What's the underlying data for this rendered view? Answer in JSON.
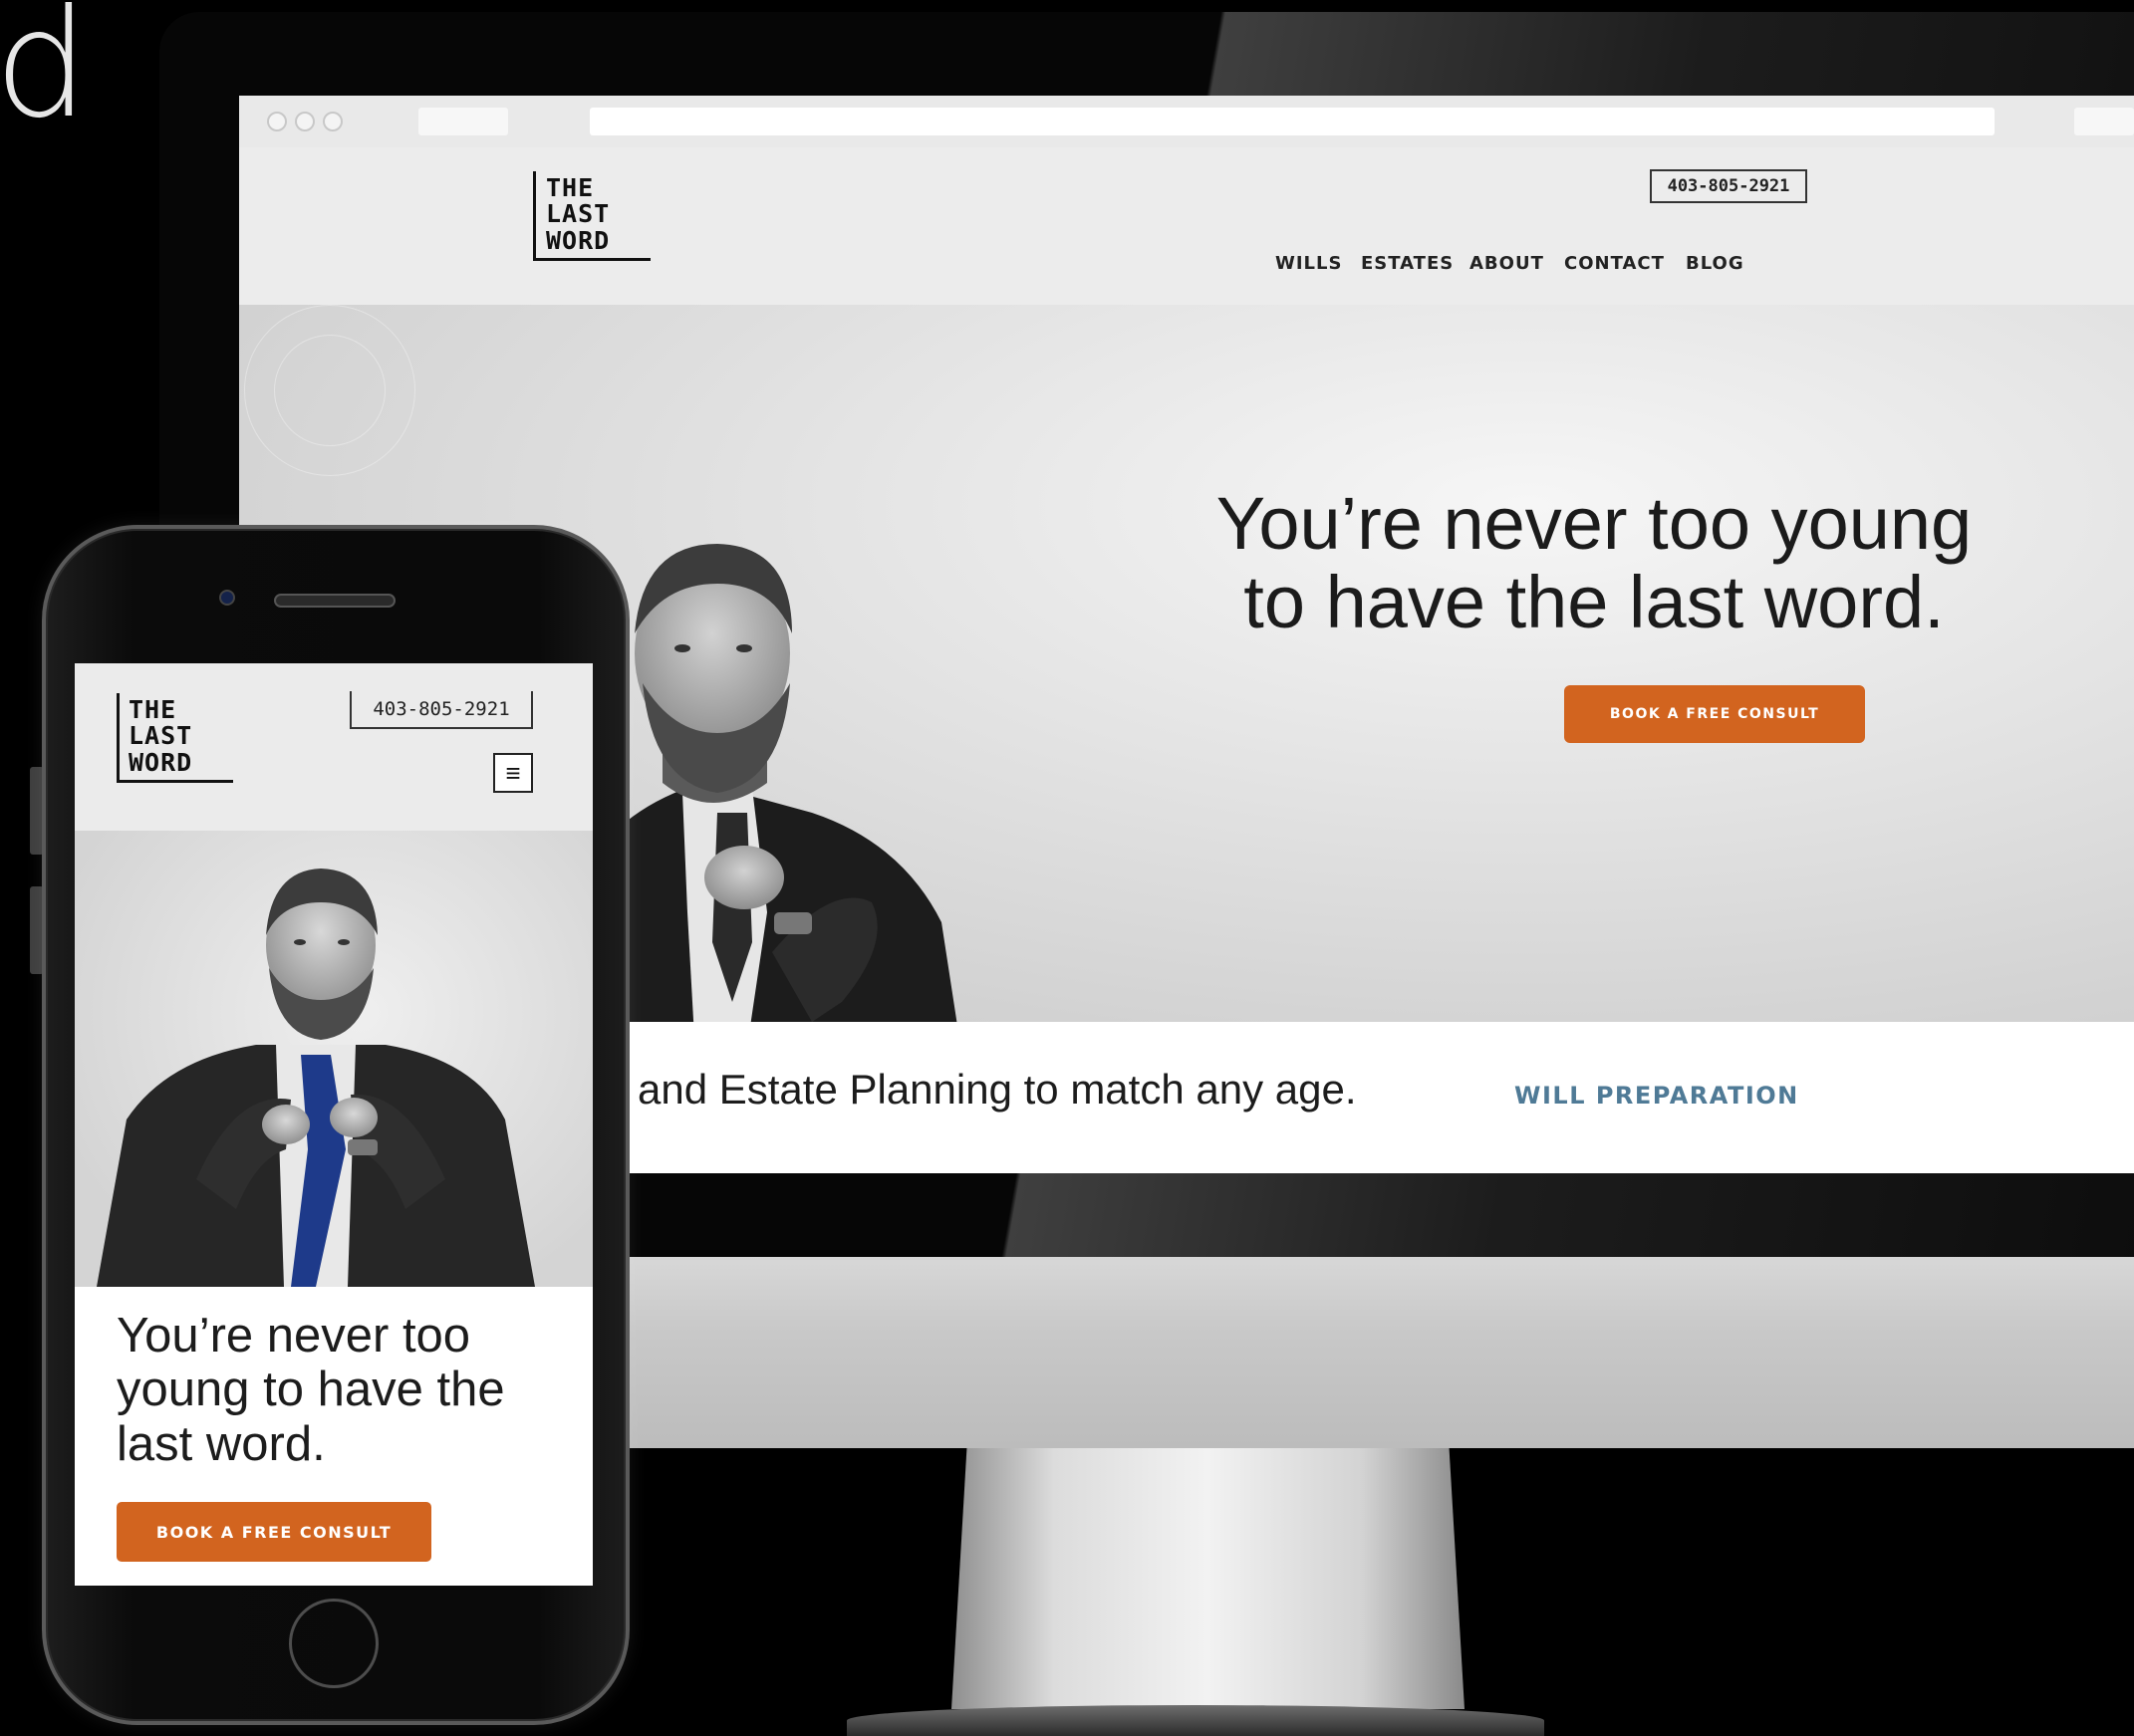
{
  "stray_text": "d",
  "brand": {
    "logo_line1": "THE",
    "logo_line2": "LAST",
    "logo_line3": "WORD"
  },
  "desktop": {
    "phone_number": "403-805-2921",
    "nav": [
      "WILLS",
      "ESTATES",
      "ABOUT",
      "CONTACT",
      "BLOG"
    ],
    "headline_line1": "You’re never too young",
    "headline_line2": "to have the last word.",
    "cta_label": "BOOK A FREE CONSULT",
    "strip_text": "and Estate Planning to match any age.",
    "strip_link": "WILL PREPARATION"
  },
  "mobile": {
    "phone_number": "403-805-2921",
    "menu_icon": "hamburger-icon",
    "headline": "You’re never too young to have the last word.",
    "cta_label": "BOOK A FREE CONSULT"
  },
  "colors": {
    "accent": "#d2641f",
    "link": "#4f7a96",
    "tie": "#1e3a8a"
  }
}
